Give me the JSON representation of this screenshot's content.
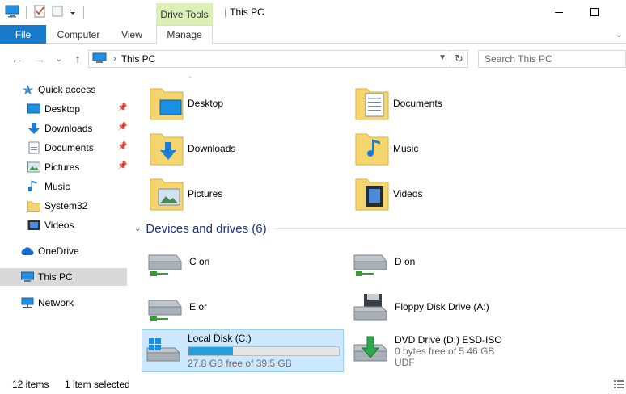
{
  "window": {
    "title": "This PC",
    "context_tab_label": "Drive Tools"
  },
  "ribbon": {
    "tabs": [
      {
        "label": "File"
      },
      {
        "label": "Computer"
      },
      {
        "label": "View"
      },
      {
        "label": "Manage"
      }
    ]
  },
  "address": {
    "path": "This PC",
    "search_placeholder": "Search This PC"
  },
  "sidebar": {
    "items": [
      {
        "label": "Quick access",
        "icon": "star-icon"
      },
      {
        "label": "Desktop",
        "icon": "desktop-icon",
        "pinned": true
      },
      {
        "label": "Downloads",
        "icon": "downloads-icon",
        "pinned": true
      },
      {
        "label": "Documents",
        "icon": "documents-icon",
        "pinned": true
      },
      {
        "label": "Pictures",
        "icon": "pictures-icon",
        "pinned": true
      },
      {
        "label": "Music",
        "icon": "music-icon"
      },
      {
        "label": "System32",
        "icon": "folder-icon"
      },
      {
        "label": "Videos",
        "icon": "videos-icon"
      },
      {
        "label": "OneDrive",
        "icon": "cloud-icon"
      },
      {
        "label": "This PC",
        "icon": "computer-icon",
        "selected": true
      },
      {
        "label": "Network",
        "icon": "network-icon"
      }
    ]
  },
  "folders": [
    {
      "label": "Desktop",
      "icon": "desktop-folder-icon"
    },
    {
      "label": "Documents",
      "icon": "documents-folder-icon"
    },
    {
      "label": "Downloads",
      "icon": "downloads-folder-icon"
    },
    {
      "label": "Music",
      "icon": "music-folder-icon"
    },
    {
      "label": "Pictures",
      "icon": "pictures-folder-icon"
    },
    {
      "label": "Videos",
      "icon": "videos-folder-icon"
    }
  ],
  "devices_group": {
    "label": "Devices and drives (6)"
  },
  "drives": [
    {
      "label": "C on",
      "icon": "network-drive-icon"
    },
    {
      "label": "D on",
      "icon": "network-drive-icon"
    },
    {
      "label": "E or",
      "icon": "network-drive-icon"
    },
    {
      "label": "Floppy Disk Drive (A:)",
      "icon": "floppy-drive-icon"
    },
    {
      "label": "Local Disk (C:)",
      "icon": "windows-drive-icon",
      "free": "27.8 GB free of 39.5 GB",
      "used_fraction": 0.296,
      "selected": true
    },
    {
      "label": "DVD Drive (D:) ESD-ISO",
      "icon": "dvd-drive-icon",
      "free": "0 bytes free of 5.46 GB",
      "fs": "UDF"
    }
  ],
  "status": {
    "count": "12 items",
    "selection": "1 item selected"
  },
  "colors": {
    "accent": "#1979ca",
    "context_tab": "#dcefb6",
    "selection": "#cce8ff",
    "usage_bar": "#26a0da",
    "group_header": "#1e3287"
  }
}
